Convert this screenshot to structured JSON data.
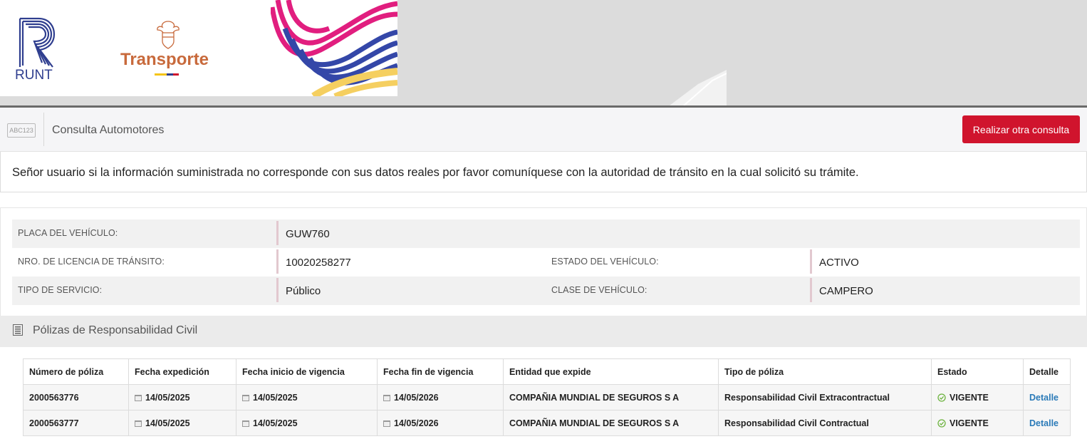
{
  "banner": {
    "runt_text": "RUNT",
    "ministry_text": "Transporte",
    "flag_colors": [
      "#f5c518",
      "#2f3e8f",
      "#d0142d"
    ]
  },
  "header": {
    "icon_text": "ABC123",
    "title": "Consulta Automotores",
    "button_label": "Realizar otra consulta"
  },
  "notice": {
    "text": "Señor usuario si la información suministrada no corresponde con sus datos reales por favor comuníquese con la autoridad de tránsito en la cual solicitó su trámite."
  },
  "vehicle": {
    "placa_label": "PLACA DEL VEHÍCULO:",
    "placa_value": "GUW760",
    "licencia_label": "NRO. DE LICENCIA DE TRÁNSITO:",
    "licencia_value": "10020258277",
    "estado_label": "ESTADO DEL VEHÍCULO:",
    "estado_value": "ACTIVO",
    "servicio_label": "TIPO DE SERVICIO:",
    "servicio_value": "Público",
    "clase_label": "CLASE DE VEHÍCULO:",
    "clase_value": "CAMPERO"
  },
  "polizas": {
    "section_title": "Pólizas de Responsabilidad Civil",
    "columns": [
      "Número de póliza",
      "Fecha expedición",
      "Fecha inicio de vigencia",
      "Fecha fin de vigencia",
      "Entidad que expide",
      "Tipo de póliza",
      "Estado",
      "Detalle"
    ],
    "rows": [
      {
        "numero": "2000563776",
        "expedicion": "14/05/2025",
        "inicio": "14/05/2025",
        "fin": "14/05/2026",
        "entidad": "COMPAÑIA MUNDIAL DE SEGUROS S A",
        "tipo": "Responsabilidad Civil Extracontractual",
        "estado": "VIGENTE",
        "detalle": "Detalle"
      },
      {
        "numero": "2000563777",
        "expedicion": "14/05/2025",
        "inicio": "14/05/2025",
        "fin": "14/05/2026",
        "entidad": "COMPAÑIA MUNDIAL DE SEGUROS S A",
        "tipo": "Responsabilidad Civil Contractual",
        "estado": "VIGENTE",
        "detalle": "Detalle"
      }
    ]
  },
  "colors": {
    "brand_red": "#d0142d",
    "link_blue": "#2a7ab8",
    "ok_green": "#6db33f"
  }
}
